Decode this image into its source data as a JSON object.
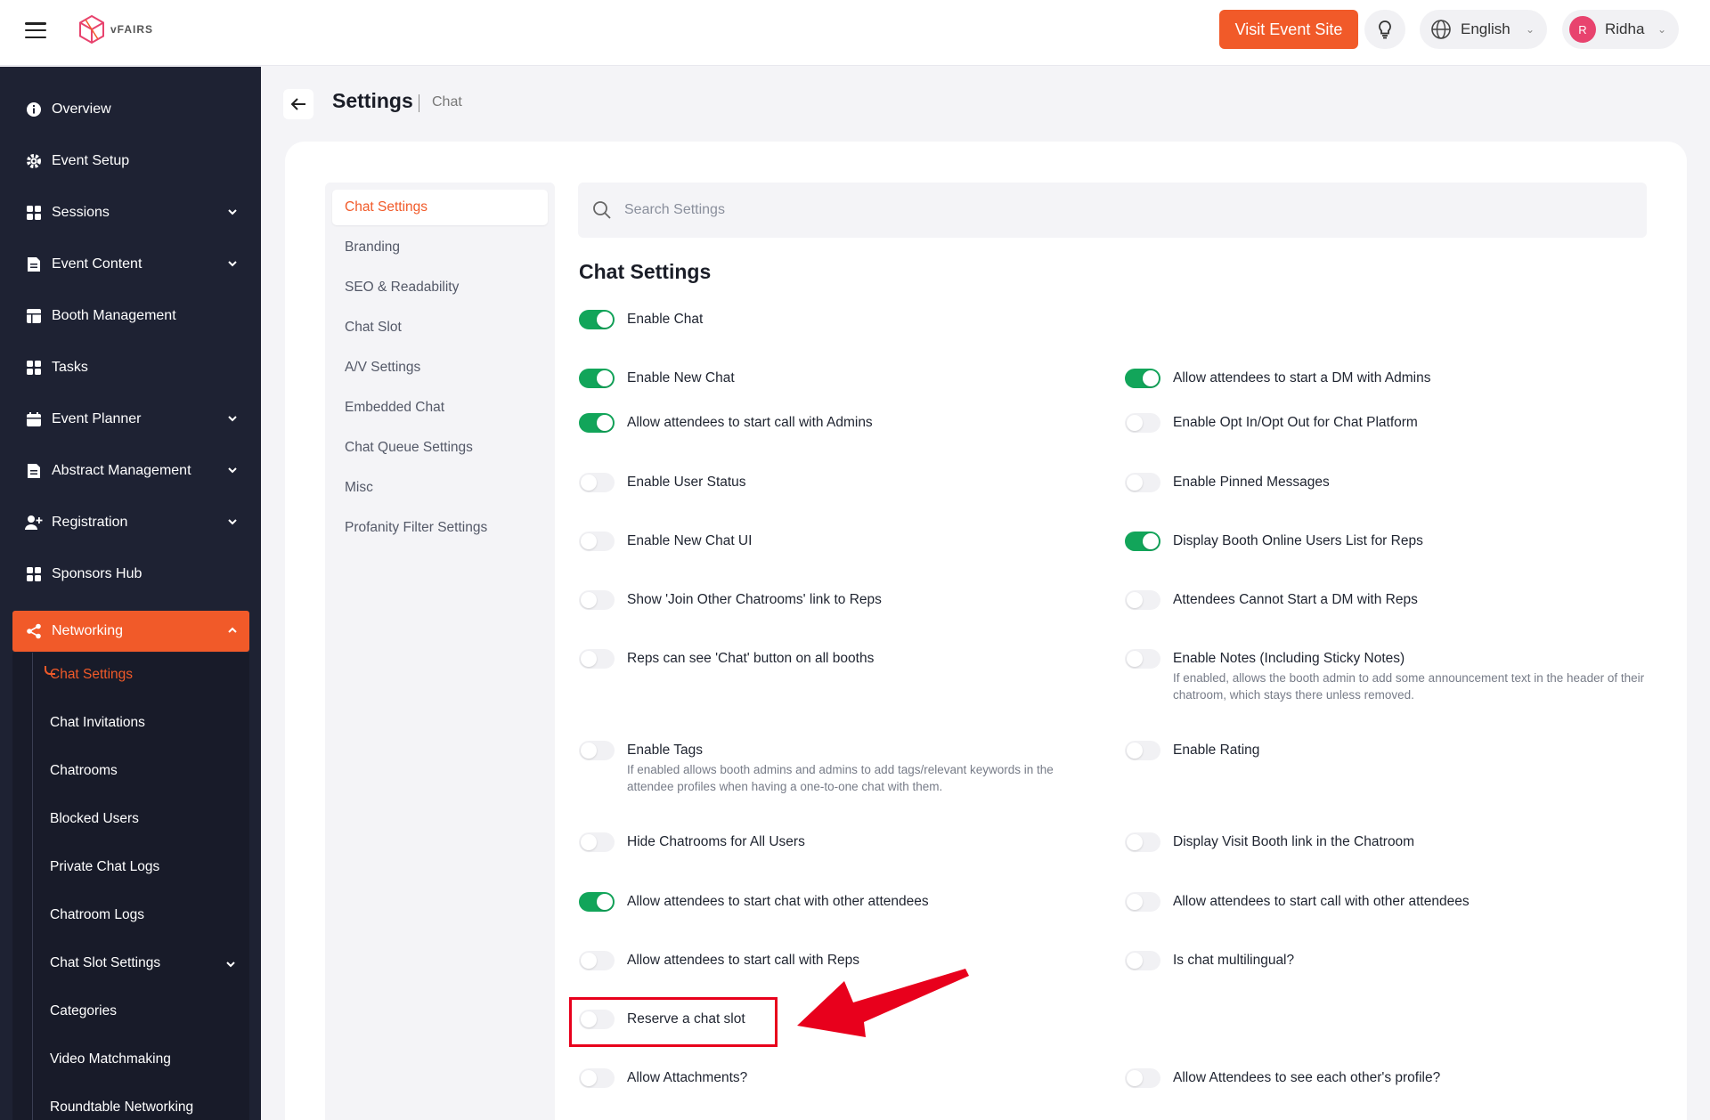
{
  "brand": {
    "logo_text": "vFAIRS",
    "accent": "#f15a29",
    "toggle_on_color": "#12a55a"
  },
  "topbar": {
    "visit_label": "Visit Event Site",
    "language": "English",
    "user_initial": "R",
    "user_name": "Ridha"
  },
  "sidebar": {
    "items": [
      {
        "label": "Overview"
      },
      {
        "label": "Event Setup"
      },
      {
        "label": "Sessions"
      },
      {
        "label": "Event Content"
      },
      {
        "label": "Booth Management"
      },
      {
        "label": "Tasks"
      },
      {
        "label": "Event Planner"
      },
      {
        "label": "Abstract Management"
      },
      {
        "label": "Registration"
      },
      {
        "label": "Sponsors Hub"
      },
      {
        "label": "Networking"
      }
    ],
    "sub_items": [
      {
        "label": "Chat Settings"
      },
      {
        "label": "Chat Invitations"
      },
      {
        "label": "Chatrooms"
      },
      {
        "label": "Blocked Users"
      },
      {
        "label": "Private Chat Logs"
      },
      {
        "label": "Chatroom Logs"
      },
      {
        "label": "Chat Slot Settings"
      },
      {
        "label": "Categories"
      },
      {
        "label": "Video Matchmaking"
      },
      {
        "label": "Roundtable Networking"
      }
    ]
  },
  "header": {
    "title": "Settings",
    "subtitle": "Chat"
  },
  "subnav": {
    "items": [
      {
        "label": "Chat Settings"
      },
      {
        "label": "Branding"
      },
      {
        "label": "SEO & Readability"
      },
      {
        "label": "Chat Slot"
      },
      {
        "label": "A/V Settings"
      },
      {
        "label": "Embedded Chat"
      },
      {
        "label": "Chat Queue Settings"
      },
      {
        "label": "Misc"
      },
      {
        "label": "Profanity Filter Settings"
      }
    ]
  },
  "search": {
    "placeholder": "Search Settings"
  },
  "section": {
    "title": "Chat Settings"
  },
  "settings": [
    {
      "label": "Enable Chat",
      "on": true
    },
    {
      "label": "Enable New Chat",
      "on": true
    },
    {
      "label": "Allow attendees to start a DM with Admins",
      "on": true
    },
    {
      "label": "Allow attendees to start call with Admins",
      "on": true
    },
    {
      "label": "Enable Opt In/Opt Out for Chat Platform",
      "on": false
    },
    {
      "label": "Enable User Status",
      "on": false
    },
    {
      "label": "Enable Pinned Messages",
      "on": false
    },
    {
      "label": "Enable New Chat UI",
      "on": false
    },
    {
      "label": "Display Booth Online Users List for Reps",
      "on": true
    },
    {
      "label": "Show 'Join Other Chatrooms' link to Reps",
      "on": false
    },
    {
      "label": "Attendees Cannot Start a DM with Reps",
      "on": false
    },
    {
      "label": "Reps can see 'Chat' button on all booths",
      "on": false
    },
    {
      "label": "Enable Notes (Including Sticky Notes)",
      "on": false,
      "desc": "If enabled, allows the booth admin to add some announcement text in the header of their chatroom, which stays there unless removed."
    },
    {
      "label": "Enable Tags",
      "on": false,
      "desc": "If enabled allows booth admins and admins to add tags/relevant keywords in the attendee profiles when having a one-to-one chat with them."
    },
    {
      "label": "Enable Rating",
      "on": false
    },
    {
      "label": "Hide Chatrooms for All Users",
      "on": false
    },
    {
      "label": "Display Visit Booth link in the Chatroom",
      "on": false
    },
    {
      "label": "Allow attendees to start chat with other attendees",
      "on": true
    },
    {
      "label": "Allow attendees to start call with other attendees",
      "on": false
    },
    {
      "label": "Allow attendees to start call with Reps",
      "on": false
    },
    {
      "label": "Is chat multilingual?",
      "on": false
    },
    {
      "label": "Reserve a chat slot",
      "on": false
    },
    {
      "label": "Allow Attachments?",
      "on": false
    },
    {
      "label": "Allow Attendees to see each other's profile?",
      "on": false
    }
  ]
}
